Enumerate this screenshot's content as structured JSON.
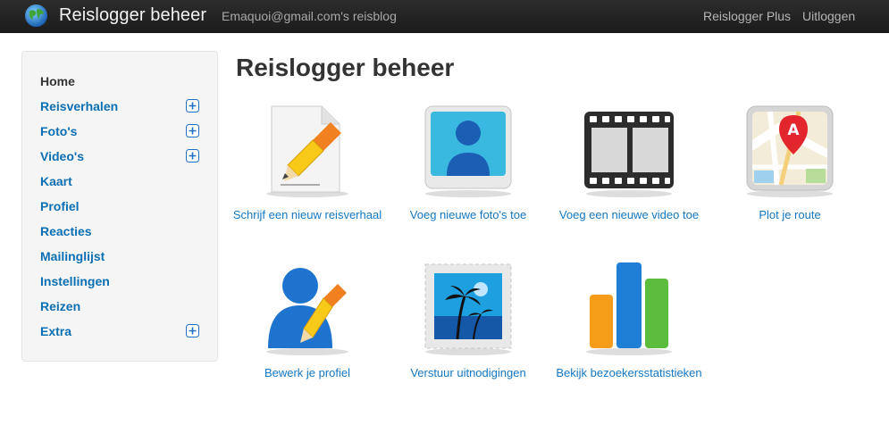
{
  "header": {
    "brand": "Reislogger beheer",
    "blog_name": "Emaquoi@gmail.com's reisblog",
    "links": [
      "Reislogger Plus",
      "Uitloggen"
    ]
  },
  "sidebar": {
    "items": [
      {
        "label": "Home",
        "active": true,
        "expandable": false
      },
      {
        "label": "Reisverhalen",
        "expandable": true
      },
      {
        "label": "Foto's",
        "expandable": true
      },
      {
        "label": "Video's",
        "expandable": true
      },
      {
        "label": "Kaart",
        "expandable": false
      },
      {
        "label": "Profiel",
        "expandable": false
      },
      {
        "label": "Reacties",
        "expandable": false
      },
      {
        "label": "Mailinglijst",
        "expandable": false
      },
      {
        "label": "Instellingen",
        "expandable": false
      },
      {
        "label": "Reizen",
        "expandable": false
      },
      {
        "label": "Extra",
        "expandable": true
      }
    ]
  },
  "main": {
    "title": "Reislogger beheer",
    "tiles": [
      {
        "icon": "write-story-icon",
        "caption": "Schrijf een nieuw reisverhaal"
      },
      {
        "icon": "add-photo-icon",
        "caption": "Voeg nieuwe foto's toe"
      },
      {
        "icon": "add-video-icon",
        "caption": "Voeg een nieuwe video toe"
      },
      {
        "icon": "map-route-icon",
        "caption": "Plot je route"
      },
      {
        "icon": "edit-profile-icon",
        "caption": "Bewerk je profiel"
      },
      {
        "icon": "send-invitation-icon",
        "caption": "Verstuur uitnodigingen"
      },
      {
        "icon": "statistics-icon",
        "caption": "Bekijk bezoekersstatistieken"
      }
    ]
  },
  "colors": {
    "navbar": "#222222",
    "link": "#1477c2",
    "sidebar_link": "#0c6fb3",
    "sidebar_bg": "#f5f5f5"
  }
}
